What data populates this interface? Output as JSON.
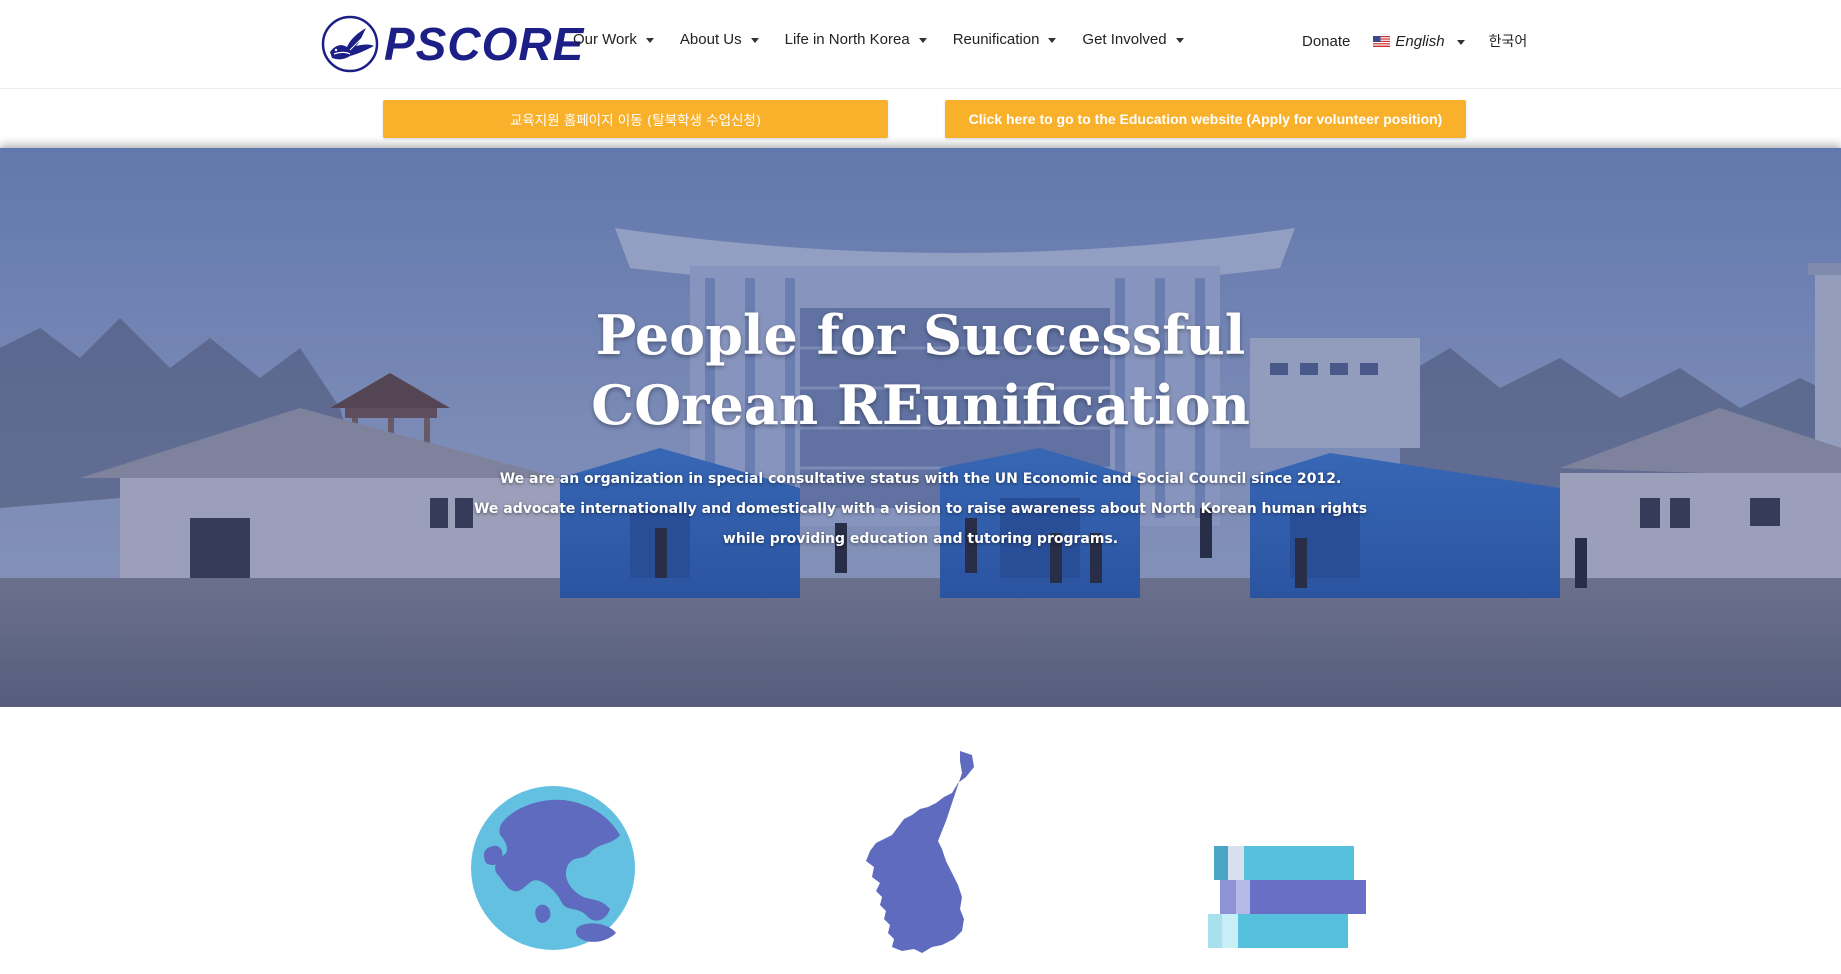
{
  "header": {
    "logo_text": "PSCORE",
    "nav": [
      {
        "label": "Our Work"
      },
      {
        "label": "About Us"
      },
      {
        "label": "Life in North Korea"
      },
      {
        "label": "Reunification"
      },
      {
        "label": "Get Involved"
      }
    ],
    "donate_label": "Donate",
    "language": {
      "label": "English",
      "flag_icon": "us-flag-icon"
    },
    "korean_label": "한국어"
  },
  "banners": {
    "korean_button": "교육지원 홈페이지 이동 (탈북학생 수업신청)",
    "english_button": "Click here to go to the Education website (Apply for volunteer position)",
    "color": "#f9b12c"
  },
  "hero": {
    "title_line1": "People for Successful",
    "title_line2": "COrean REunification",
    "subtitle_line1": "We are an organization in special consultative status with the UN Economic and Social Council since 2012.",
    "subtitle_line2": "We advocate internationally and domestically with a vision to raise awareness about North Korean human rights",
    "subtitle_line3": "while providing education and tutoring programs."
  },
  "icons": [
    "globe-icon",
    "korea-map-icon",
    "books-icon"
  ],
  "colors": {
    "brand_navy": "#1c1f86",
    "accent_orange": "#f9b12c",
    "icon_purple": "#5e6bbf",
    "icon_cyan": "#4fbfdc"
  }
}
